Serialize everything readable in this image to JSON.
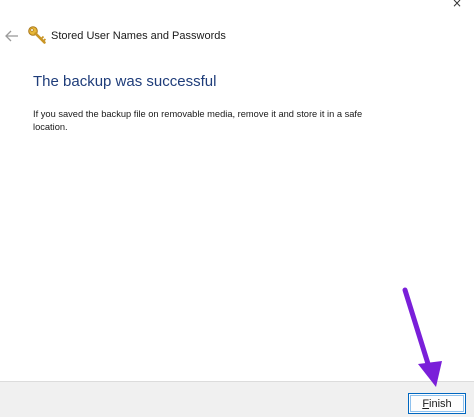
{
  "window": {
    "title": "Stored User Names and Passwords",
    "close_glyph": "×",
    "icons": {
      "back": "back-arrow-icon",
      "app": "key-icon",
      "annotation": "purple-arrow-icon"
    }
  },
  "main": {
    "heading": "The backup was successful",
    "message": "If you saved the backup file on removable media, remove it and store it in a safe location."
  },
  "footer": {
    "finish_accel": "F",
    "finish_rest": "inish"
  },
  "colors": {
    "heading": "#1f3d7a",
    "footer_bg": "#f0f0f0",
    "button_border": "#0067c0",
    "annotation_arrow": "#7a1fd9"
  }
}
